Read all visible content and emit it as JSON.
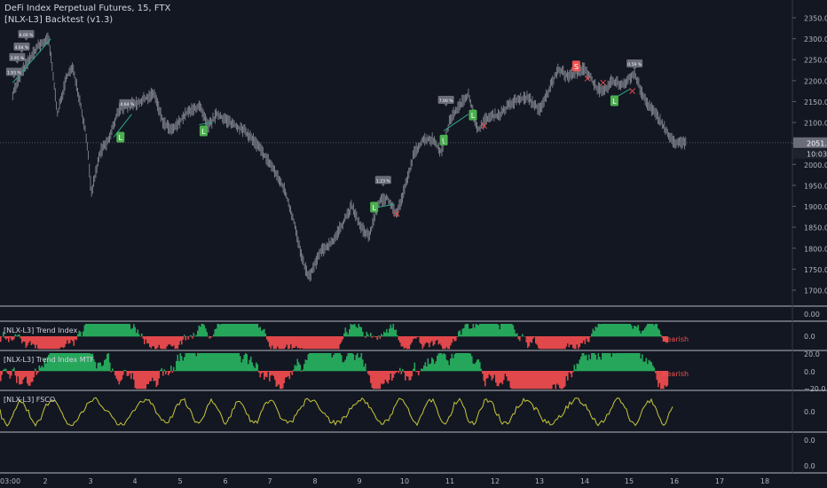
{
  "header": {
    "title": "DeFi Index Perpetual Futures, 15, FTX",
    "indicator": "[NLX-L3] Backtest (v1.3)"
  },
  "price_axis": {
    "ticks": [
      "2350.0",
      "2300.0",
      "2250.0",
      "2200.0",
      "2150.0",
      "2100.0",
      "2050.0",
      "2000.0",
      "1950.0",
      "1900.0",
      "1850.0",
      "1800.0",
      "1750.0",
      "1700.0"
    ],
    "last_price": "2051.9",
    "countdown": "10:03",
    "last_price_color": "#363a45"
  },
  "panes": [
    {
      "title": "[NLX-L3] Trend Index",
      "ticks": [
        "0.00",
        "0.0"
      ],
      "status": "Bearish"
    },
    {
      "title": "[NLX-L3] Trend Index MTF",
      "ticks": [
        "20.0",
        "0.0",
        "−20.0"
      ],
      "status": "Bearish"
    },
    {
      "title": "[NLX-L3] FSCO",
      "ticks": [
        "0.0"
      ]
    },
    {
      "title": "",
      "ticks": [
        "0.0",
        "0.0"
      ]
    }
  ],
  "time_axis": {
    "labels": [
      "03:00",
      "2",
      "3",
      "4",
      "5",
      "6",
      "7",
      "8",
      "9",
      "10",
      "11",
      "12",
      "13",
      "14",
      "15",
      "16",
      "17",
      "18"
    ]
  },
  "signals": {
    "long_label": "L",
    "short_label": "S",
    "trade_labels": [
      "6.00 %",
      "4.64 %",
      "3.95 %",
      "1.93 %",
      "4.64 %",
      "1.23 %",
      "7.00 %",
      "0.59 %"
    ]
  },
  "colors": {
    "background": "#131722",
    "candle": "#9598a1",
    "bull": "#26a65b",
    "bear": "#e0484b",
    "oscillator": "#c8c83a",
    "trail": "#2fa88a",
    "long_label_bg": "#4caf50",
    "short_label_bg": "#f05350",
    "trade_label_bg": "#6a6d78",
    "divider": "#d1d4dc"
  },
  "chart_data": {
    "type": "line",
    "title": "DeFi Index Perpetual Futures, 15, FTX",
    "ylim": [
      1685,
      2380
    ],
    "x_range": [
      0.75,
      18.6
    ],
    "price_path": [
      [
        0.75,
        2170
      ],
      [
        1.0,
        2230
      ],
      [
        1.3,
        2280
      ],
      [
        1.55,
        2300
      ],
      [
        1.75,
        2120
      ],
      [
        1.95,
        2210
      ],
      [
        2.1,
        2230
      ],
      [
        2.25,
        2150
      ],
      [
        2.4,
        2060
      ],
      [
        2.5,
        1930
      ],
      [
        2.7,
        2030
      ],
      [
        2.9,
        2060
      ],
      [
        3.1,
        2130
      ],
      [
        3.3,
        2140
      ],
      [
        3.6,
        2150
      ],
      [
        3.9,
        2170
      ],
      [
        4.1,
        2100
      ],
      [
        4.3,
        2080
      ],
      [
        4.6,
        2120
      ],
      [
        4.9,
        2140
      ],
      [
        5.1,
        2090
      ],
      [
        5.3,
        2120
      ],
      [
        5.6,
        2100
      ],
      [
        5.9,
        2080
      ],
      [
        6.1,
        2060
      ],
      [
        6.3,
        2030
      ],
      [
        6.5,
        2000
      ],
      [
        6.8,
        1940
      ],
      [
        7.0,
        1870
      ],
      [
        7.2,
        1770
      ],
      [
        7.35,
        1730
      ],
      [
        7.6,
        1790
      ],
      [
        7.9,
        1820
      ],
      [
        8.1,
        1860
      ],
      [
        8.3,
        1900
      ],
      [
        8.5,
        1850
      ],
      [
        8.7,
        1830
      ],
      [
        8.9,
        1910
      ],
      [
        9.1,
        1920
      ],
      [
        9.3,
        1880
      ],
      [
        9.5,
        1950
      ],
      [
        9.7,
        2030
      ],
      [
        9.9,
        2060
      ],
      [
        10.1,
        2060
      ],
      [
        10.3,
        2030
      ],
      [
        10.5,
        2110
      ],
      [
        10.7,
        2140
      ],
      [
        10.9,
        2170
      ],
      [
        11.1,
        2080
      ],
      [
        11.3,
        2110
      ],
      [
        11.6,
        2120
      ],
      [
        11.9,
        2150
      ],
      [
        12.2,
        2160
      ],
      [
        12.5,
        2130
      ],
      [
        12.7,
        2180
      ],
      [
        12.9,
        2230
      ],
      [
        13.1,
        2210
      ],
      [
        13.3,
        2220
      ],
      [
        13.5,
        2230
      ],
      [
        13.7,
        2190
      ],
      [
        13.9,
        2170
      ],
      [
        14.1,
        2200
      ],
      [
        14.3,
        2190
      ],
      [
        14.6,
        2215
      ],
      [
        14.8,
        2160
      ],
      [
        15.0,
        2130
      ],
      [
        15.2,
        2100
      ],
      [
        15.4,
        2060
      ],
      [
        15.6,
        2050
      ],
      [
        15.75,
        2052
      ]
    ],
    "long_signals": [
      {
        "x": 3.15,
        "y": 2065
      },
      {
        "x": 5.0,
        "y": 2080
      },
      {
        "x": 8.8,
        "y": 1898
      },
      {
        "x": 10.35,
        "y": 2058
      },
      {
        "x": 11.0,
        "y": 2118
      },
      {
        "x": 14.15,
        "y": 2152
      }
    ],
    "short_signals": [
      {
        "x": 13.3,
        "y": 2235
      }
    ],
    "trade_labels": [
      {
        "x": 1.05,
        "y": 2310,
        "text": "6.00 %"
      },
      {
        "x": 0.95,
        "y": 2280,
        "text": "4.64 %"
      },
      {
        "x": 0.85,
        "y": 2255,
        "text": "3.95 %"
      },
      {
        "x": 0.78,
        "y": 2220,
        "text": "1.93 %"
      },
      {
        "x": 3.3,
        "y": 2145,
        "text": "4.64 %"
      },
      {
        "x": 9.0,
        "y": 1962,
        "text": "1.23 %"
      },
      {
        "x": 10.4,
        "y": 2153,
        "text": "7.00 %"
      },
      {
        "x": 14.6,
        "y": 2240,
        "text": "0.59 %"
      }
    ]
  }
}
